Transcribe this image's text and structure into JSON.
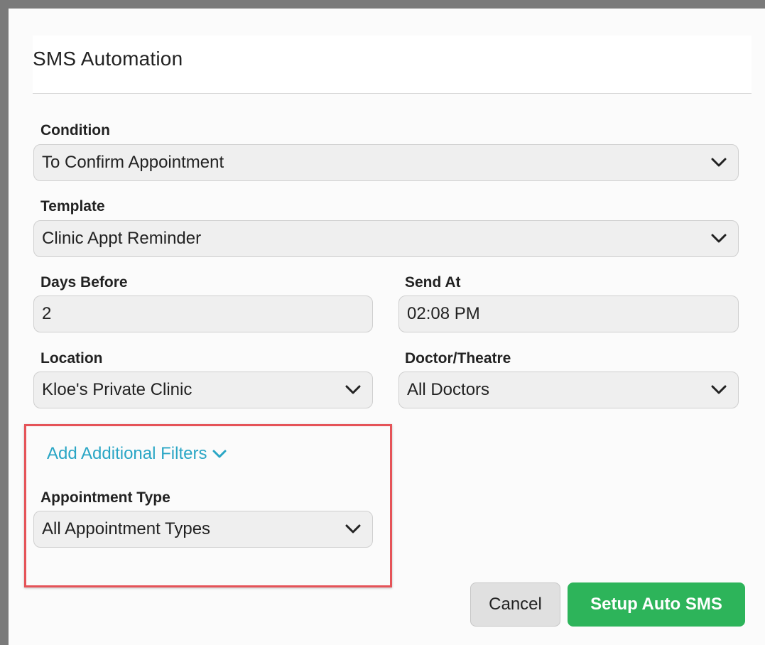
{
  "dialog": {
    "title": "SMS Automation"
  },
  "form": {
    "condition": {
      "label": "Condition",
      "value": "To Confirm Appointment"
    },
    "template": {
      "label": "Template",
      "value": "Clinic Appt Reminder"
    },
    "days_before": {
      "label": "Days Before",
      "value": "2"
    },
    "send_at": {
      "label": "Send At",
      "value": "02:08 PM"
    },
    "location": {
      "label": "Location",
      "value": "Kloe's Private Clinic"
    },
    "doctor": {
      "label": "Doctor/Theatre",
      "value": "All Doctors"
    },
    "additional_filters_link": "Add Additional Filters",
    "appointment_type": {
      "label": "Appointment Type",
      "value": "All Appointment Types"
    }
  },
  "buttons": {
    "cancel": "Cancel",
    "submit": "Setup Auto SMS"
  },
  "colors": {
    "link": "#2aa6c5",
    "primary": "#2db45a",
    "highlight_border": "#e55358"
  },
  "icons": {
    "select_chevron": "chevron-down-icon"
  }
}
